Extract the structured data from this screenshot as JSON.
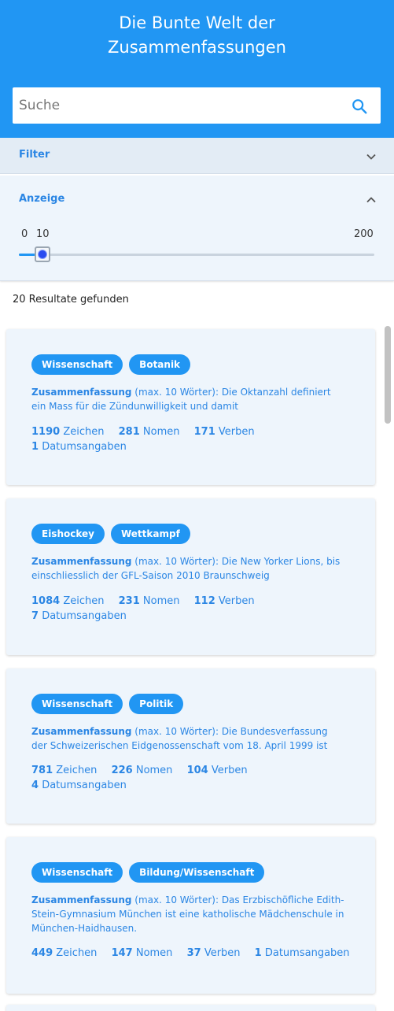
{
  "header": {
    "title_line1": "Die Bunte Welt der",
    "title_line2": "Zusammenfassungen",
    "color": "#2196f3"
  },
  "search": {
    "placeholder": "Suche",
    "value": "",
    "icon": "search-icon"
  },
  "filter_panel": {
    "label": "Filter",
    "expanded": false,
    "icon": "chevron-down-icon"
  },
  "display_panel": {
    "label": "Anzeige",
    "expanded": true,
    "icon": "chevron-up-icon",
    "slider": {
      "min_label": "0",
      "value_label": "10",
      "max_label": "200",
      "value": 10,
      "min": 0,
      "max": 200
    }
  },
  "results": {
    "count_text": "20 Resultate gefunden",
    "cards": [
      {
        "tags": [
          "Wissenschaft",
          "Botanik"
        ],
        "summary_label": "Zusammenfassung",
        "summary_meta": " (max. 10 Wörter): ",
        "summary_text": "Die Oktanzahl definiert ein Mass für die Zündunwilligkeit und damit",
        "stats": [
          {
            "value": "1190",
            "label": "Zeichen"
          },
          {
            "value": "281",
            "label": "Nomen"
          },
          {
            "value": "171",
            "label": "Verben"
          },
          {
            "value": "1",
            "label": "Datumsangaben"
          }
        ]
      },
      {
        "tags": [
          "Eishockey",
          "Wettkampf"
        ],
        "summary_label": "Zusammenfassung",
        "summary_meta": " (max. 10 Wörter): ",
        "summary_text": "Die New Yorker Lions, bis einschliesslich der GFL-Saison 2010 Braunschweig",
        "stats": [
          {
            "value": "1084",
            "label": "Zeichen"
          },
          {
            "value": "231",
            "label": "Nomen"
          },
          {
            "value": "112",
            "label": "Verben"
          },
          {
            "value": "7",
            "label": "Datumsangaben"
          }
        ]
      },
      {
        "tags": [
          "Wissenschaft",
          "Politik"
        ],
        "summary_label": "Zusammenfassung",
        "summary_meta": " (max. 10 Wörter): ",
        "summary_text": "Die Bundesverfassung der Schweizerischen Eidgenossenschaft vom 18. April 1999 ist",
        "stats": [
          {
            "value": "781",
            "label": "Zeichen"
          },
          {
            "value": "226",
            "label": "Nomen"
          },
          {
            "value": "104",
            "label": "Verben"
          },
          {
            "value": "4",
            "label": "Datumsangaben"
          }
        ]
      },
      {
        "tags": [
          "Wissenschaft",
          "Bildung/Wissenschaft"
        ],
        "summary_label": "Zusammenfassung",
        "summary_meta": " (max. 10 Wörter): ",
        "summary_text": "Das Erzbischöfliche Edith-Stein-Gymnasium München ist eine katholische Mädchenschule in München-Haidhausen.",
        "stats": [
          {
            "value": "449",
            "label": "Zeichen"
          },
          {
            "value": "147",
            "label": "Nomen"
          },
          {
            "value": "37",
            "label": "Verben"
          },
          {
            "value": "1",
            "label": "Datumsangaben"
          }
        ]
      }
    ]
  }
}
